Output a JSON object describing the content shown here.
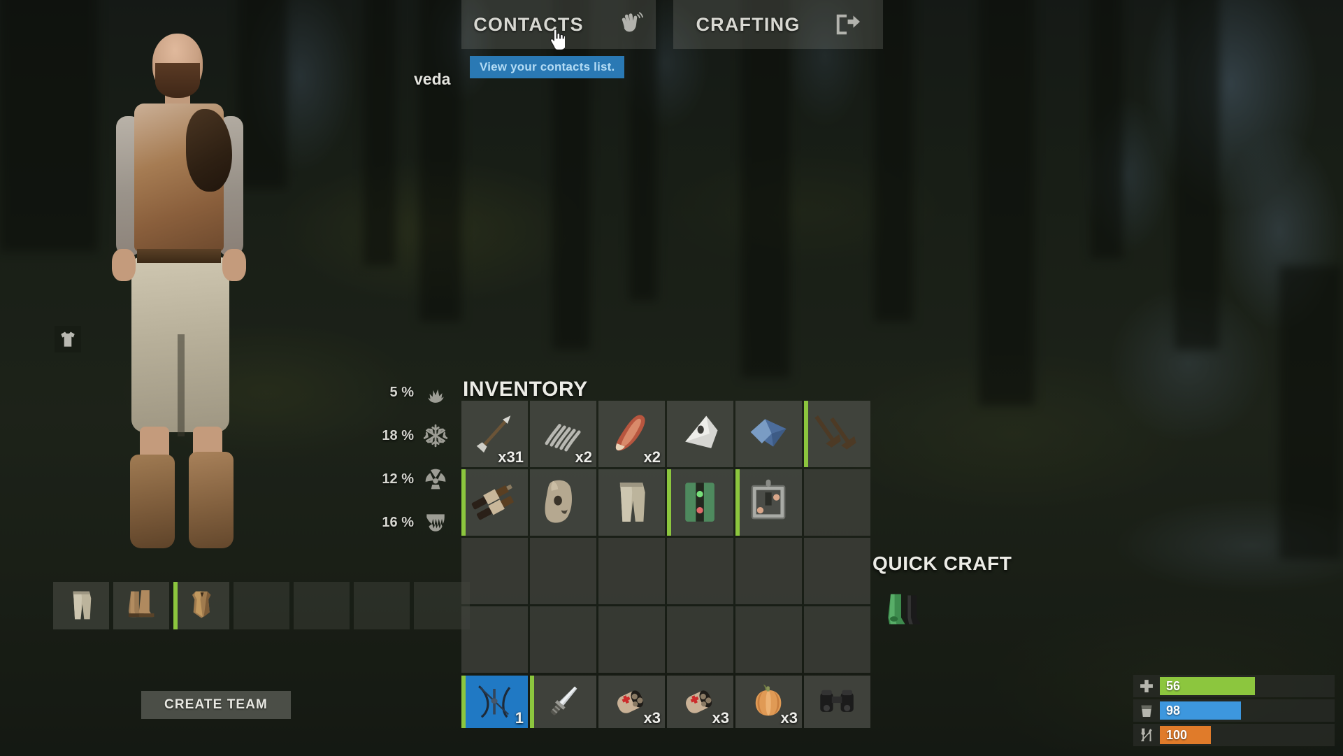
{
  "header": {
    "tabs": [
      {
        "label": "CONTACTS",
        "icon": "wave-hand-icon",
        "active": true
      },
      {
        "label": "CRAFTING",
        "icon": "exit-arrow-icon",
        "active": false
      }
    ],
    "tooltip": "View your contacts list.",
    "cursor_icon": "pointing-hand-cursor"
  },
  "player": {
    "name": "veda"
  },
  "shirt_toggle": {
    "icon": "tshirt-icon"
  },
  "resistances": [
    {
      "value": "5 %",
      "icon": "heat-spike-icon"
    },
    {
      "value": "18 %",
      "icon": "snowflake-cold-icon"
    },
    {
      "value": "12 %",
      "icon": "radiation-icon"
    },
    {
      "value": "16 %",
      "icon": "bite-fangs-icon"
    }
  ],
  "equipment": {
    "slots": [
      {
        "icon": "cloth-pants-icon",
        "durability": 0,
        "empty": false
      },
      {
        "icon": "leather-boots-icon",
        "durability": 0,
        "empty": false
      },
      {
        "icon": "leather-vest-icon",
        "durability": 78,
        "empty": false
      },
      {
        "icon": "",
        "durability": 0,
        "empty": true
      },
      {
        "icon": "",
        "durability": 0,
        "empty": true
      },
      {
        "icon": "",
        "durability": 0,
        "empty": true
      },
      {
        "icon": "",
        "durability": 0,
        "empty": true
      }
    ]
  },
  "create_team_button": {
    "label": "CREATE TEAM"
  },
  "inventory": {
    "title": "INVENTORY",
    "columns": 6,
    "rows": 4,
    "slots": [
      {
        "icon": "arrow-icon",
        "qty": "x31",
        "durability": 0,
        "empty": false,
        "selected": false
      },
      {
        "icon": "metal-spring-icon",
        "qty": "x2",
        "durability": 0,
        "empty": false,
        "selected": false
      },
      {
        "icon": "raw-meat-icon",
        "qty": "x2",
        "durability": 0,
        "empty": false,
        "selected": false
      },
      {
        "icon": "metal-fragment-icon",
        "qty": "",
        "durability": 0,
        "empty": false,
        "selected": false
      },
      {
        "icon": "blue-cloth-icon",
        "qty": "",
        "durability": 0,
        "empty": false,
        "selected": false
      },
      {
        "icon": "engine-valves-icon",
        "qty": "",
        "durability": 92,
        "empty": false,
        "selected": false
      },
      {
        "icon": "spark-plugs-icon",
        "qty": "",
        "durability": 92,
        "empty": false,
        "selected": false
      },
      {
        "icon": "burlap-mask-icon",
        "qty": "",
        "durability": 0,
        "empty": false,
        "selected": false
      },
      {
        "icon": "cloth-pants-icon",
        "qty": "",
        "durability": 0,
        "empty": false,
        "selected": false
      },
      {
        "icon": "electrical-switch-icon",
        "qty": "",
        "durability": 92,
        "empty": false,
        "selected": false
      },
      {
        "icon": "fuse-box-icon",
        "qty": "",
        "durability": 92,
        "empty": false,
        "selected": false
      },
      {
        "icon": "",
        "qty": "",
        "durability": 0,
        "empty": true,
        "selected": false
      },
      {
        "icon": "",
        "qty": "",
        "durability": 0,
        "empty": true,
        "selected": false
      },
      {
        "icon": "",
        "qty": "",
        "durability": 0,
        "empty": true,
        "selected": false
      },
      {
        "icon": "",
        "qty": "",
        "durability": 0,
        "empty": true,
        "selected": false
      },
      {
        "icon": "",
        "qty": "",
        "durability": 0,
        "empty": true,
        "selected": false
      },
      {
        "icon": "",
        "qty": "",
        "durability": 0,
        "empty": true,
        "selected": false
      },
      {
        "icon": "",
        "qty": "",
        "durability": 0,
        "empty": true,
        "selected": false
      },
      {
        "icon": "",
        "qty": "",
        "durability": 0,
        "empty": true,
        "selected": false
      },
      {
        "icon": "",
        "qty": "",
        "durability": 0,
        "empty": true,
        "selected": false
      },
      {
        "icon": "",
        "qty": "",
        "durability": 0,
        "empty": true,
        "selected": false
      },
      {
        "icon": "",
        "qty": "",
        "durability": 0,
        "empty": true,
        "selected": false
      },
      {
        "icon": "",
        "qty": "",
        "durability": 0,
        "empty": true,
        "selected": false
      },
      {
        "icon": "",
        "qty": "",
        "durability": 0,
        "empty": true,
        "selected": false
      }
    ]
  },
  "hotbar": {
    "slots": [
      {
        "icon": "crossbow-icon",
        "qty": "1",
        "durability": 85,
        "empty": false,
        "selected": true
      },
      {
        "icon": "machete-icon",
        "qty": "",
        "durability": 85,
        "empty": false,
        "selected": false
      },
      {
        "icon": "bandage-icon",
        "qty": "x3",
        "durability": 0,
        "empty": false,
        "selected": false
      },
      {
        "icon": "bandage-icon",
        "qty": "x3",
        "durability": 0,
        "empty": false,
        "selected": false
      },
      {
        "icon": "pumpkin-icon",
        "qty": "x3",
        "durability": 0,
        "empty": false,
        "selected": false
      },
      {
        "icon": "binoculars-icon",
        "qty": "",
        "durability": 0,
        "empty": false,
        "selected": false
      }
    ]
  },
  "quick_craft": {
    "title": "QUICK CRAFT",
    "items": [
      {
        "icon": "rubber-boots-icon"
      }
    ]
  },
  "vitals": [
    {
      "name": "health",
      "icon": "cross-health-icon",
      "value": "56",
      "percent": 56,
      "color": "#8cc63e"
    },
    {
      "name": "water",
      "icon": "water-glass-icon",
      "value": "98",
      "percent": 48,
      "color": "#3d97de"
    },
    {
      "name": "food",
      "icon": "fork-knife-icon",
      "value": "100",
      "percent": 30,
      "color": "#e07b2a"
    }
  ],
  "colors": {
    "accent_blue": "#2079c4",
    "tooltip_bg": "#2a79b4",
    "durability_green": "#8cc63e",
    "health_green": "#8cc63e",
    "water_blue": "#3d97de",
    "food_orange": "#e07b2a"
  }
}
